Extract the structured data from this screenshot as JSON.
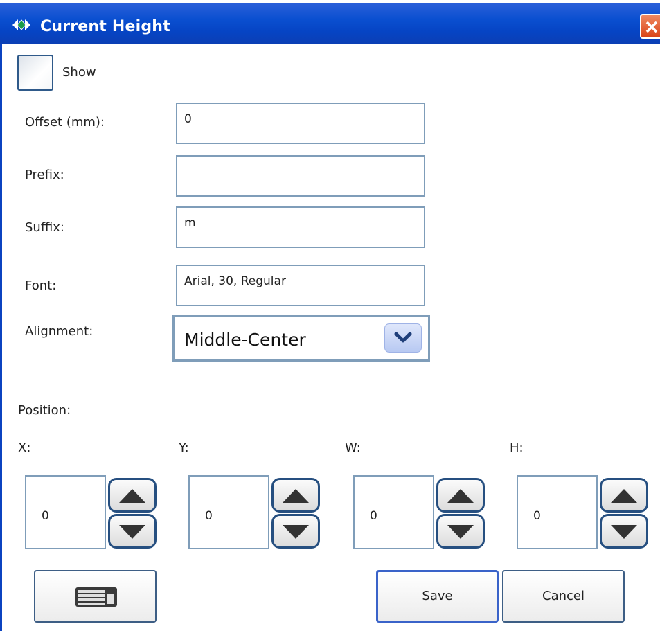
{
  "window": {
    "title": "Current Height"
  },
  "show": {
    "label": "Show",
    "checked": false
  },
  "fields": {
    "offset": {
      "label": "Offset (mm):",
      "value": "0"
    },
    "prefix": {
      "label": "Prefix:",
      "value": ""
    },
    "suffix": {
      "label": "Suffix:",
      "value": "m"
    },
    "font": {
      "label": "Font:",
      "value": "Arial, 30, Regular"
    }
  },
  "alignment": {
    "label": "Alignment:",
    "value": "Middle-Center"
  },
  "position": {
    "label": "Position:",
    "x": {
      "label": "X:",
      "value": "0"
    },
    "y": {
      "label": "Y:",
      "value": "0"
    },
    "w": {
      "label": "W:",
      "value": "0"
    },
    "h": {
      "label": "H:",
      "value": "0"
    }
  },
  "buttons": {
    "keyboard_icon": "keyboard-icon",
    "save": "Save",
    "cancel": "Cancel"
  },
  "colors": {
    "titlebar": "#0a4fd0",
    "close": "#d84318",
    "border": "#7f9db9"
  }
}
